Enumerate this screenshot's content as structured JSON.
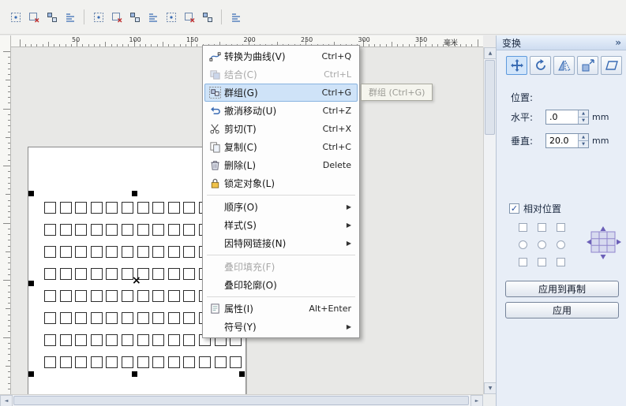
{
  "icons": {
    "collapse": "»",
    "submenu_arrow": "▶",
    "spin_up": "▲",
    "spin_down": "▼",
    "scroll_up": "▲",
    "scroll_down": "▼",
    "scroll_left": "◄",
    "scroll_right": "►",
    "check": "✓",
    "x_marker": "×"
  },
  "toolbar": {
    "groups": [
      {
        "icons": [
          "toolbar-icon-1",
          "toolbar-icon-2",
          "toolbar-icon-3",
          "toolbar-icon-4"
        ]
      },
      {
        "icons": [
          "toolbar-icon-5",
          "toolbar-icon-6",
          "toolbar-icon-7",
          "toolbar-icon-8",
          "toolbar-icon-9",
          "toolbar-icon-10",
          "toolbar-icon-11"
        ]
      },
      {
        "icons": [
          "toolbar-icon-12"
        ]
      }
    ]
  },
  "ruler": {
    "h_ticks": [
      "50",
      "100",
      "150",
      "200",
      "250",
      "300",
      "350"
    ],
    "unit": "毫米"
  },
  "context_menu": {
    "items": [
      {
        "name": "convert-to-curves",
        "label": "转换为曲线(V)",
        "shortcut": "Ctrl+Q",
        "icon": "curve-icon"
      },
      {
        "name": "combine",
        "label": "结合(C)",
        "shortcut": "Ctrl+L",
        "icon": "combine-icon",
        "state": "disabled"
      },
      {
        "name": "group",
        "label": "群组(G)",
        "shortcut": "Ctrl+G",
        "icon": "group-icon",
        "state": "highlighted"
      },
      {
        "name": "undo-move",
        "label": "撤消移动(U)",
        "shortcut": "Ctrl+Z",
        "icon": "undo-icon"
      },
      {
        "name": "cut",
        "label": "剪切(T)",
        "shortcut": "Ctrl+X",
        "icon": "cut-icon"
      },
      {
        "name": "copy",
        "label": "复制(C)",
        "shortcut": "Ctrl+C",
        "icon": "copy-icon"
      },
      {
        "name": "delete",
        "label": "删除(L)",
        "shortcut": "Delete",
        "icon": "delete-icon"
      },
      {
        "name": "lock-object",
        "label": "锁定对象(L)",
        "icon": "lock-icon"
      },
      {
        "type": "separator"
      },
      {
        "name": "order",
        "label": "顺序(O)",
        "submenu": true
      },
      {
        "name": "styles",
        "label": "样式(S)",
        "submenu": true
      },
      {
        "name": "internet-links",
        "label": "因特网链接(N)",
        "submenu": true
      },
      {
        "type": "separator"
      },
      {
        "name": "overprint-fill",
        "label": "叠印填充(F)",
        "state": "disabled"
      },
      {
        "name": "overprint-outline",
        "label": "叠印轮廓(O)"
      },
      {
        "type": "separator"
      },
      {
        "name": "properties",
        "label": "属性(I)",
        "shortcut": "Alt+Enter",
        "icon": "properties-icon"
      },
      {
        "name": "symbol",
        "label": "符号(Y)",
        "submenu": true
      }
    ]
  },
  "tooltip": {
    "text": "群组 (Ctrl+G)"
  },
  "artboard": {
    "grid_rows": 8,
    "grid_cols": 13
  },
  "docker": {
    "title": "变换",
    "tools": [
      "position-icon",
      "rotate-icon",
      "scale-mirror-icon",
      "size-icon",
      "skew-icon"
    ],
    "active_tool": 0,
    "position_label": "位置:",
    "horizontal": {
      "label": "水平:",
      "value": ".0",
      "unit": "mm"
    },
    "vertical": {
      "label": "垂直:",
      "value": "20.0",
      "unit": "mm"
    },
    "relative": {
      "label": "相对位置",
      "checked": true
    },
    "anchor_grid": [
      [
        "checkbox",
        "checkbox",
        "checkbox"
      ],
      [
        "radio",
        "radio",
        "radio"
      ],
      [
        "checkbox",
        "checkbox",
        "checkbox"
      ]
    ],
    "apply_dup_label": "应用到再制",
    "apply_label": "应用"
  }
}
